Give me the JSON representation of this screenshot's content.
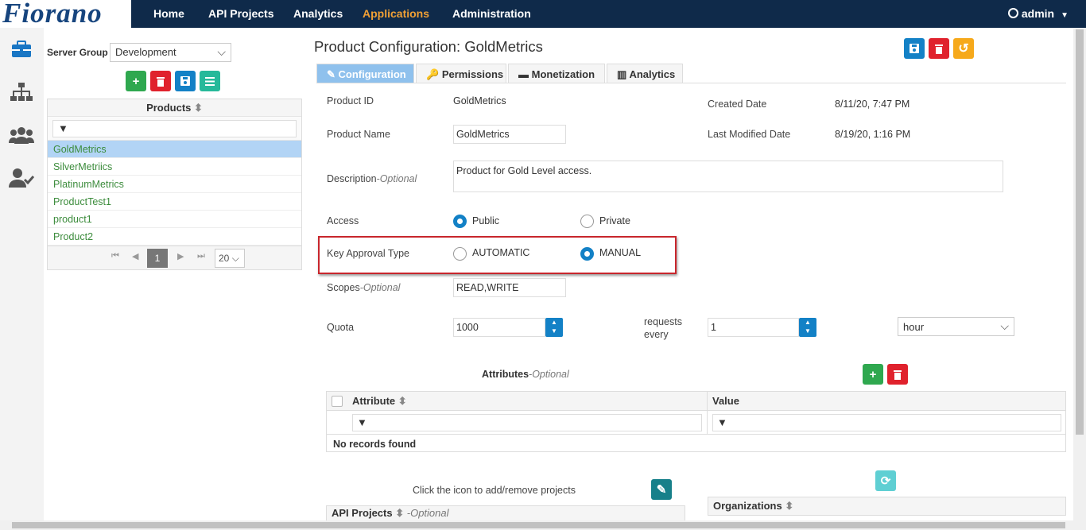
{
  "nav": {
    "logo": "Fiorano",
    "links": [
      "Home",
      "API Projects",
      "Analytics",
      "Applications",
      "Administration"
    ],
    "user": "admin"
  },
  "sidebar": {
    "icons": [
      "briefcase-icon",
      "sitemap-icon",
      "users-icon",
      "user-check-icon"
    ]
  },
  "left_panel": {
    "server_group_label": "Server Group",
    "server_group_value": "Development",
    "products_header": "Products",
    "products": [
      "GoldMetrics",
      "SilverMetriics",
      "PlatinumMetrics",
      "ProductTest1",
      "product1",
      "Product2"
    ],
    "selected_product": "GoldMetrics",
    "current_page": "1",
    "page_size": "20"
  },
  "main": {
    "title": "Product Configuration: GoldMetrics",
    "tabs": [
      "Configuration",
      "Permissions",
      "Monetization",
      "Analytics"
    ],
    "active_tab": "Configuration",
    "product_id_label": "Product ID",
    "product_id": "GoldMetrics",
    "product_name_label": "Product Name",
    "product_name": "GoldMetrics",
    "created_label": "Created Date",
    "created": "8/11/20, 7:47 PM",
    "modified_label": "Last Modified Date",
    "modified": "8/19/20, 1:16 PM",
    "description_label": "Description",
    "optional": "-Optional",
    "description": "Product for Gold Level access.",
    "access_label": "Access",
    "access_public": "Public",
    "access_private": "Private",
    "access_selected": "Public",
    "key_approval_label": "Key Approval Type",
    "key_auto": "AUTOMATIC",
    "key_manual": "MANUAL",
    "key_selected": "MANUAL",
    "scopes_label": "Scopes",
    "scopes": "READ,WRITE",
    "quota_label": "Quota",
    "quota": "1000",
    "requests_every": "requests",
    "every": "every",
    "quota_interval": "1",
    "quota_unit": "hour",
    "attributes_label": "Attributes",
    "attr_col": "Attribute",
    "value_col": "Value",
    "no_records": "No records found",
    "projects_hint": "Click the icon to add/remove projects",
    "api_projects_label": "API Projects",
    "organizations_label": "Organizations"
  }
}
